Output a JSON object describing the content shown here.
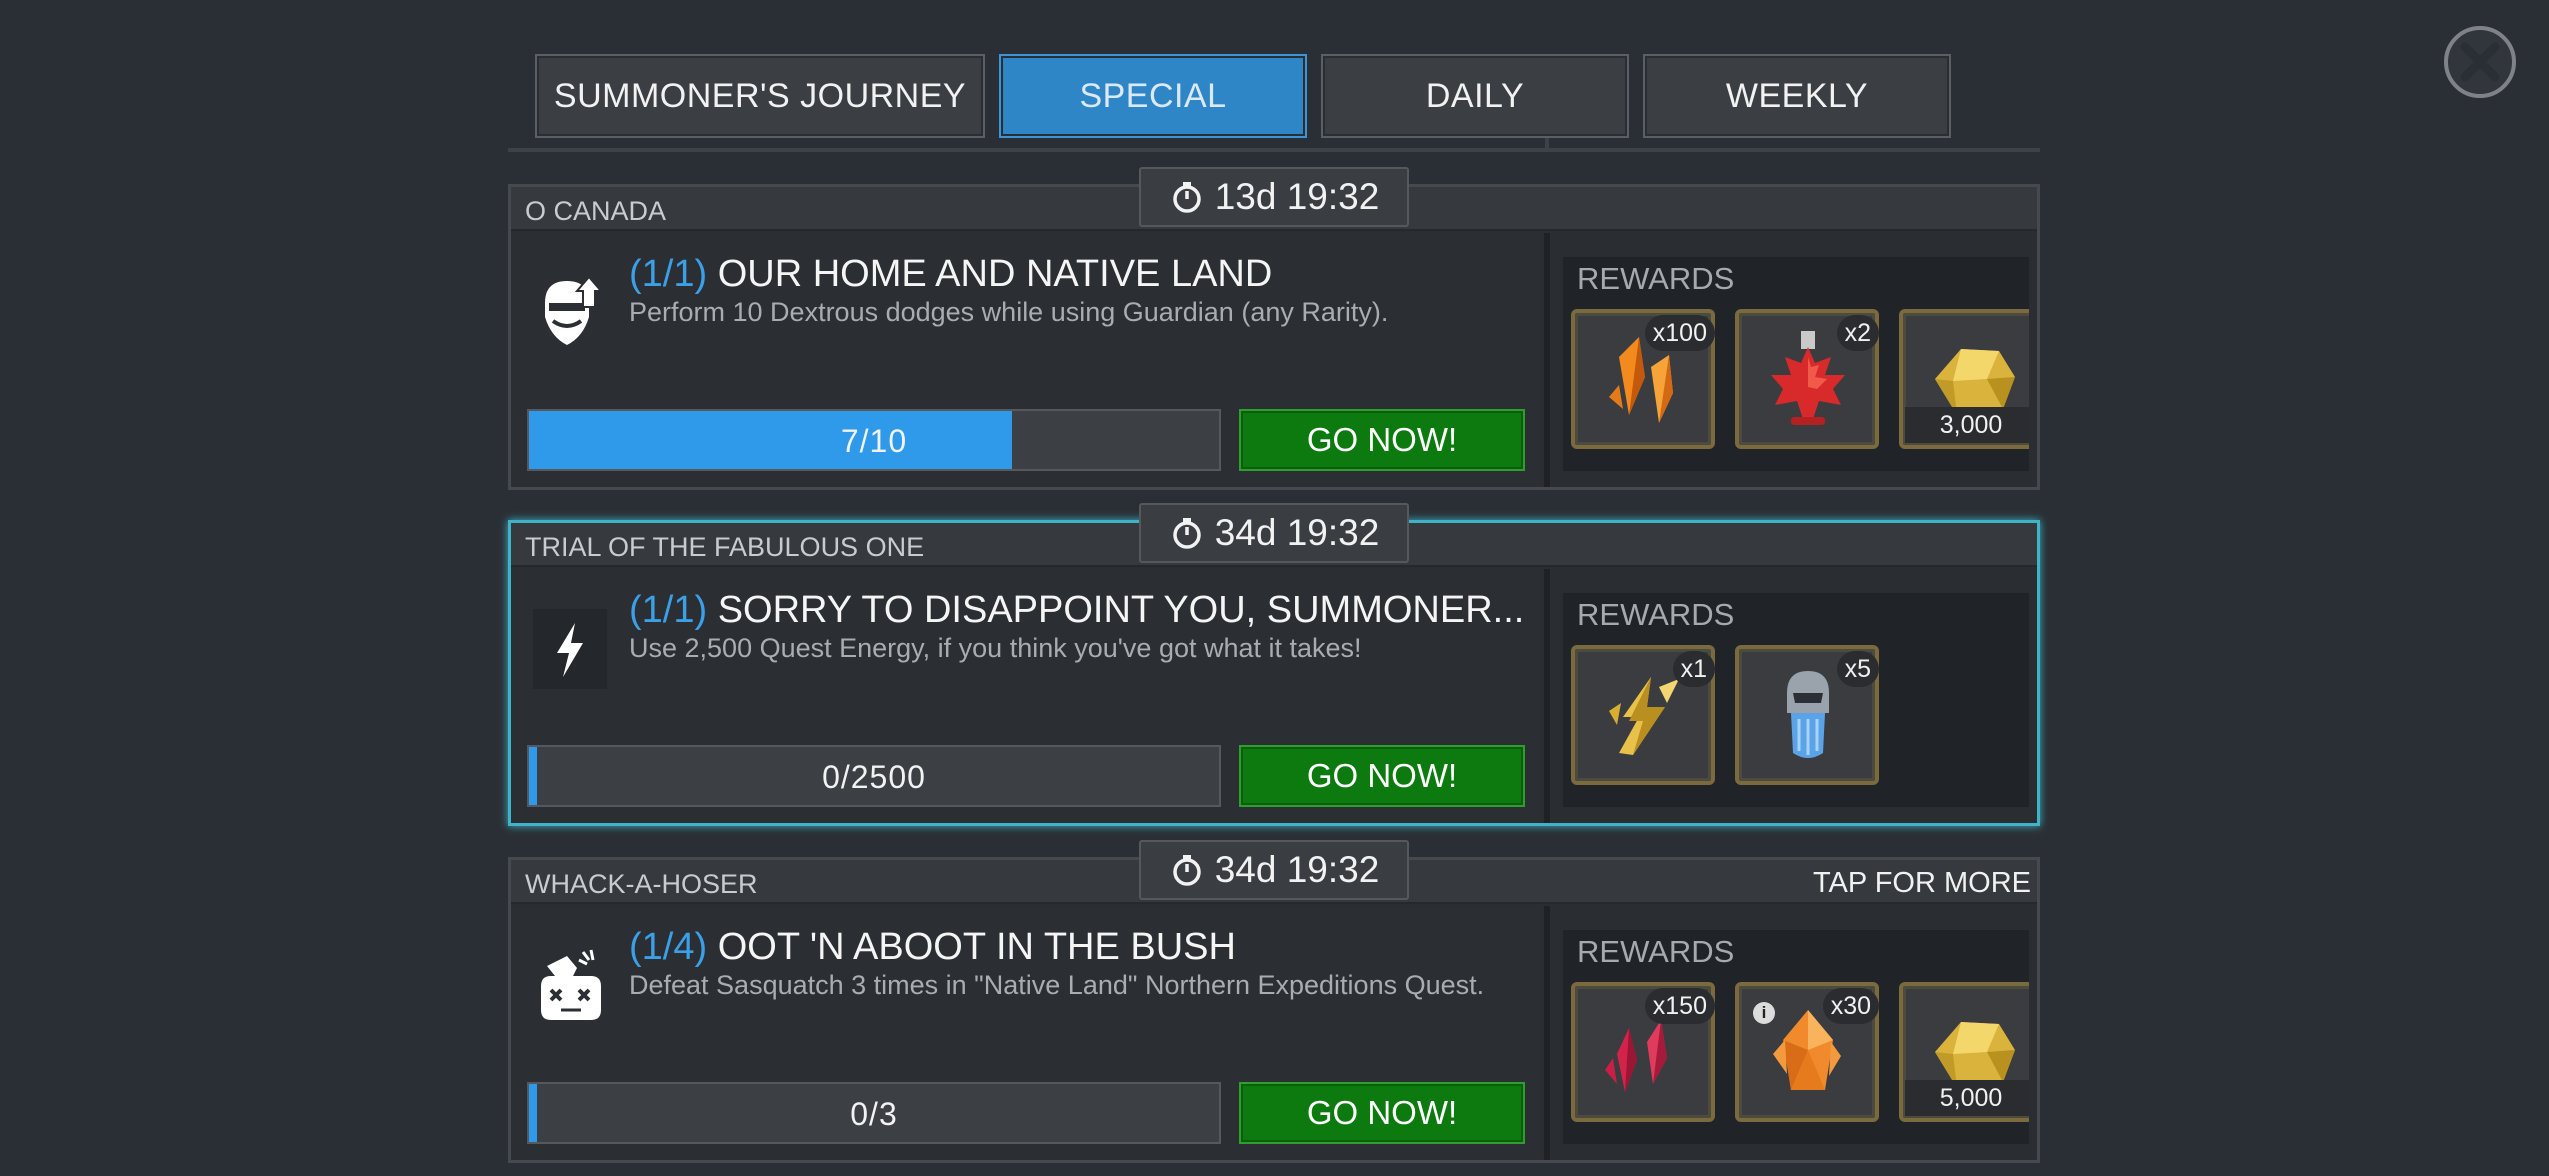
{
  "tabs": [
    {
      "label": "SUMMONER'S JOURNEY",
      "active": false
    },
    {
      "label": "SPECIAL",
      "active": true
    },
    {
      "label": "DAILY",
      "active": false
    },
    {
      "label": "WEEKLY",
      "active": false
    }
  ],
  "close_icon": "close-icon",
  "rewards_label": "REWARDS",
  "go_label": "GO NOW!",
  "quests": [
    {
      "category": "O CANADA",
      "timer": "13d 19:32",
      "progress_tag": "(1/1)",
      "title": "OUR HOME AND NATIVE LAND",
      "description": "Perform 10 Dextrous dodges while using Guardian (any Rarity).",
      "progress_text": "7/10",
      "progress_fraction": 0.7,
      "icon": "guardian-class-icon",
      "rewards": [
        {
          "icon": "orange-shard-icon",
          "qty": "x100"
        },
        {
          "icon": "maple-potion-icon",
          "qty": "x2"
        },
        {
          "icon": "gold-icon",
          "amount": "3,000"
        }
      ]
    },
    {
      "category": "TRIAL OF THE FABULOUS ONE",
      "timer": "34d 19:32",
      "progress_tag": "(1/1)",
      "title": "SORRY TO DISAPPOINT YOU, SUMMONER...",
      "description": "Use 2,500 Quest Energy, if you think you've got what it takes!",
      "progress_text": "0/2500",
      "progress_fraction": 0.0,
      "icon": "lightning-icon",
      "rewards": [
        {
          "icon": "gold-lightning-icon",
          "qty": "x1"
        },
        {
          "icon": "energy-refill-icon",
          "qty": "x5"
        }
      ]
    },
    {
      "category": "WHACK-A-HOSER",
      "timer": "34d 19:32",
      "tap_more": "TAP FOR MORE",
      "progress_tag": "(1/4)",
      "title": "OOT 'N ABOOT IN THE BUSH",
      "description": "Defeat Sasquatch 3 times in \"Native Land\" Northern Expeditions Quest.",
      "progress_text": "0/3",
      "progress_fraction": 0.0,
      "icon": "defeat-enemy-icon",
      "rewards": [
        {
          "icon": "red-crystal-shards-icon",
          "qty": "x150"
        },
        {
          "icon": "orange-crystal-icon",
          "qty": "x30",
          "info": "i"
        },
        {
          "icon": "gold-icon",
          "amount": "5,000"
        }
      ]
    }
  ]
}
